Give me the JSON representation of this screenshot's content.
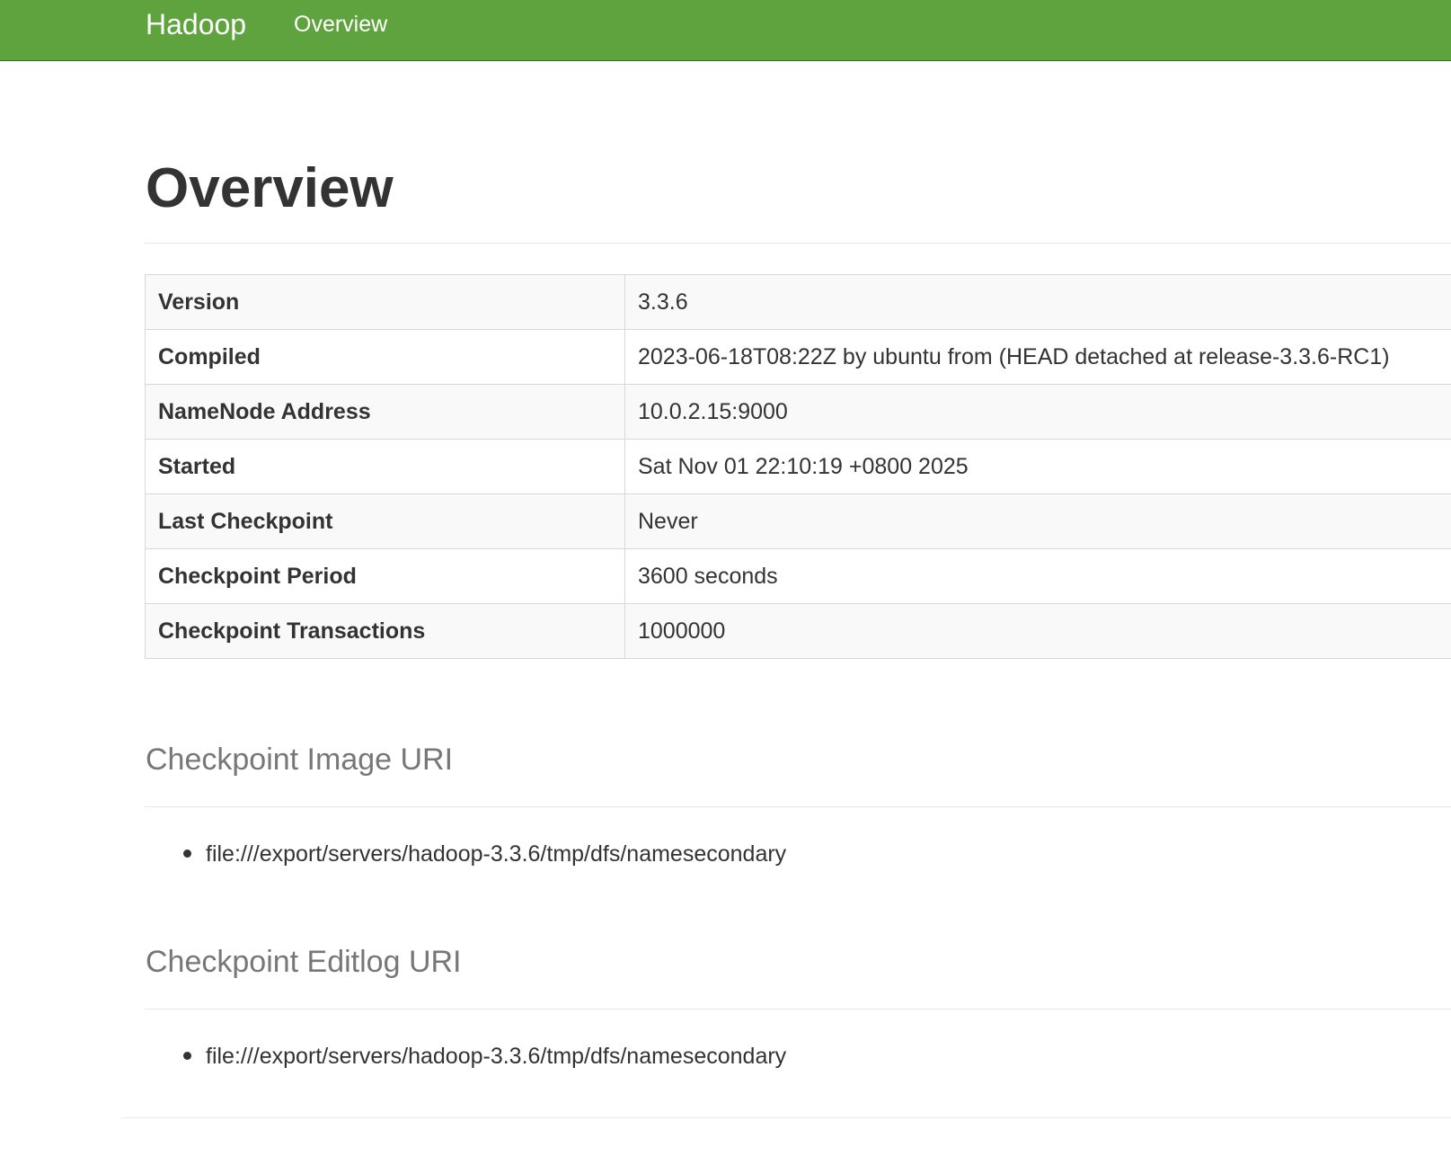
{
  "navbar": {
    "brand": "Hadoop",
    "links": [
      "Overview"
    ],
    "color": "#5fa33e"
  },
  "page_title": "Overview",
  "info_table": [
    {
      "key": "Version",
      "value": "3.3.6"
    },
    {
      "key": "Compiled",
      "value": "2023-06-18T08:22Z by ubuntu from (HEAD detached at release-3.3.6-RC1)"
    },
    {
      "key": "NameNode Address",
      "value": "10.0.2.15:9000"
    },
    {
      "key": "Started",
      "value": "Sat Nov 01 22:10:19 +0800 2025"
    },
    {
      "key": "Last Checkpoint",
      "value": "Never"
    },
    {
      "key": "Checkpoint Period",
      "value": "3600 seconds"
    },
    {
      "key": "Checkpoint Transactions",
      "value": "1000000"
    }
  ],
  "image_uri": {
    "title": "Checkpoint Image URI",
    "items": [
      "file:///export/servers/hadoop-3.3.6/tmp/dfs/namesecondary"
    ]
  },
  "editlog_uri": {
    "title": "Checkpoint Editlog URI",
    "items": [
      "file:///export/servers/hadoop-3.3.6/tmp/dfs/namesecondary"
    ]
  }
}
